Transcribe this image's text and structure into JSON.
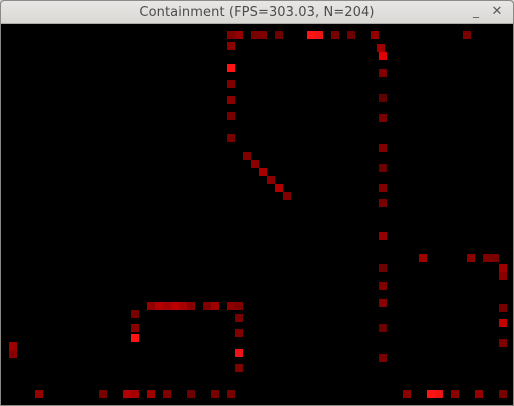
{
  "window": {
    "title": "Containment (FPS=303.03, N=204)",
    "minimize_glyph": "_",
    "close_glyph": "✕"
  },
  "simulation": {
    "background_color": "#000000",
    "particle_color_bright": "#ff1a1a",
    "particle_color_dim": "#4a0000"
  }
}
